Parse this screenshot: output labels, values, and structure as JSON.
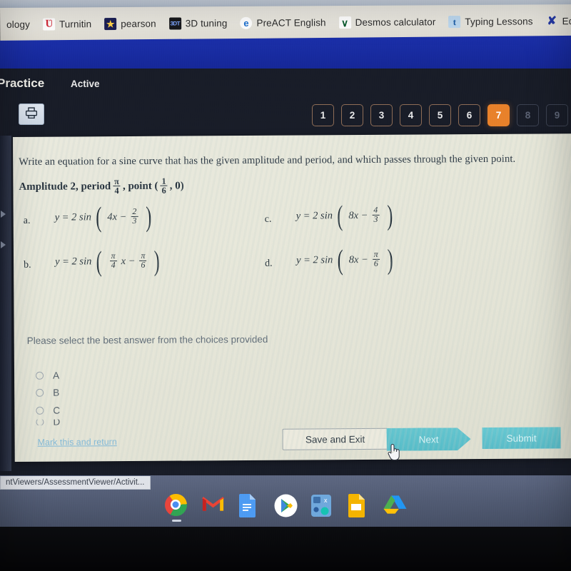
{
  "browser": {
    "address_ghost": "",
    "bookmarks": [
      {
        "label": "ology",
        "icon": "generic-bookmark-icon",
        "icon_class": "",
        "icon_glyph": "",
        "partial": true
      },
      {
        "label": "Turnitin",
        "icon": "turnitin-icon",
        "icon_class": "ic-turnitin",
        "icon_glyph": "Ʋ"
      },
      {
        "label": "pearson",
        "icon": "pearson-icon",
        "icon_class": "ic-pearson",
        "icon_glyph": "★"
      },
      {
        "label": "3D tuning",
        "icon": "3dtuning-icon",
        "icon_class": "ic-3d",
        "icon_glyph": "3DT"
      },
      {
        "label": "PreACT English",
        "icon": "preact-icon",
        "icon_class": "ic-preact",
        "icon_glyph": "e"
      },
      {
        "label": "Desmos calculator",
        "icon": "desmos-icon",
        "icon_class": "ic-desmos",
        "icon_glyph": "∨"
      },
      {
        "label": "Typing Lessons",
        "icon": "typing-icon",
        "icon_class": "ic-typing",
        "icon_glyph": "t"
      },
      {
        "label": "Ed",
        "icon": "edgenuity-icon",
        "icon_class": "ic-edg",
        "icon_glyph": "✘",
        "partial": true
      }
    ]
  },
  "app": {
    "title": "Practice",
    "status": "Active",
    "print_icon": "printer-icon",
    "pager": {
      "items": [
        {
          "label": "1",
          "state": "available"
        },
        {
          "label": "2",
          "state": "available"
        },
        {
          "label": "3",
          "state": "available"
        },
        {
          "label": "4",
          "state": "available"
        },
        {
          "label": "5",
          "state": "available"
        },
        {
          "label": "6",
          "state": "available"
        },
        {
          "label": "7",
          "state": "current"
        },
        {
          "label": "8",
          "state": "disabled"
        },
        {
          "label": "9",
          "state": "disabled"
        }
      ],
      "current_color": "#e8802a"
    }
  },
  "question": {
    "stem": "Write an equation for a sine curve that has the given amplitude and period, and which passes through the given point.",
    "given": {
      "amplitude_text": "Amplitude 2, period",
      "period_num": "π",
      "period_den": "4",
      "point_prefix": ", point (",
      "point_num": "1",
      "point_den": "6",
      "point_suffix": ", 0)"
    },
    "choices": [
      {
        "tag": "a.",
        "lhs": "y = 2 sin",
        "term": "4x −",
        "frac_num": "2",
        "frac_den": "3"
      },
      {
        "tag": "b.",
        "lhs": "y = 2 sin",
        "lead_num": "π",
        "lead_den": "4",
        "term": "x −",
        "frac_num": "π",
        "frac_den": "6"
      },
      {
        "tag": "c.",
        "lhs": "y = 2 sin",
        "term": "8x −",
        "frac_num": "4",
        "frac_den": "3"
      },
      {
        "tag": "d.",
        "lhs": "y = 2 sin",
        "term": "8x −",
        "frac_num": "π",
        "frac_den": "6"
      }
    ],
    "prompt": "Please select the best answer from the choices provided",
    "radio_options": [
      {
        "label": "A",
        "selected": false
      },
      {
        "label": "B",
        "selected": false
      },
      {
        "label": "C",
        "selected": false
      },
      {
        "label": "D",
        "selected": false
      }
    ]
  },
  "actions": {
    "mark_link": "Mark this and return",
    "save_exit": "Save and Exit",
    "next": "Next",
    "submit": "Submit"
  },
  "status_bar": {
    "url": "ntViewers/AssessmentViewer/Activit..."
  },
  "shelf": {
    "icons": [
      {
        "name": "chrome-icon",
        "label": "Chrome"
      },
      {
        "name": "gmail-icon",
        "label": "Gmail"
      },
      {
        "name": "google-docs-icon",
        "label": "Docs"
      },
      {
        "name": "play-store-icon",
        "label": "Play Store"
      },
      {
        "name": "calculator-icon",
        "label": "Calculator"
      },
      {
        "name": "google-slides-icon",
        "label": "Slides"
      },
      {
        "name": "google-drive-icon",
        "label": "Drive"
      }
    ]
  }
}
